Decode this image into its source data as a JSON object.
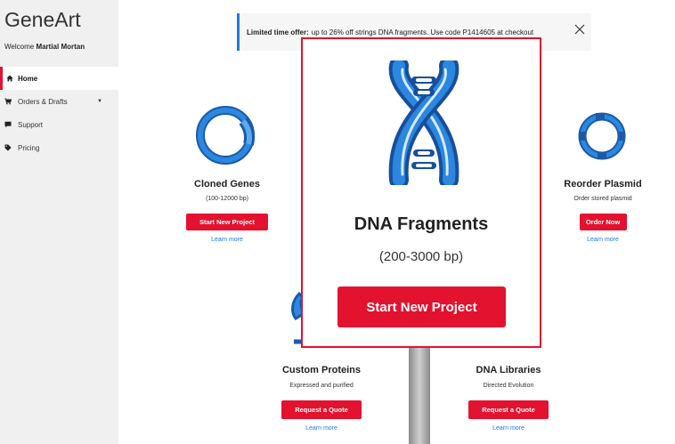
{
  "brand": "GeneArt",
  "welcome": {
    "prefix": "Welcome",
    "user": "Martial Mortan"
  },
  "sidebar": {
    "items": [
      {
        "label": "Home",
        "icon": "home-icon"
      },
      {
        "label": "Orders & Drafts",
        "icon": "cart-icon"
      },
      {
        "label": "Support",
        "icon": "chat-icon"
      },
      {
        "label": "Pricing",
        "icon": "tag-icon"
      }
    ]
  },
  "banner": {
    "bold": "Limited time offer:",
    "text": "up to 26% off strings DNA fragments. Use code P1414605 at checkout"
  },
  "cards": {
    "cloned_genes": {
      "title": "Cloned Genes",
      "sub": "(100-12000 bp)",
      "button": "Start New Project",
      "learn": "Learn more"
    },
    "reorder_plasmid": {
      "title": "Reorder Plasmid",
      "sub": "Order stored plasmid",
      "button": "Order Now",
      "learn": "Learn more"
    },
    "custom_proteins": {
      "title": "Custom Proteins",
      "sub": "Expressed and purified",
      "button": "Request a Quote",
      "learn": "Learn more"
    },
    "dna_libraries": {
      "title": "DNA Libraries",
      "sub": "Directed Evolution",
      "button": "Request a Quote",
      "learn": "Learn more"
    }
  },
  "popup": {
    "title": "DNA Fragments",
    "sub": "(200-3000 bp)",
    "button": "Start New Project"
  },
  "colors": {
    "accent": "#e3122f",
    "blue": "#1f7ae0"
  }
}
